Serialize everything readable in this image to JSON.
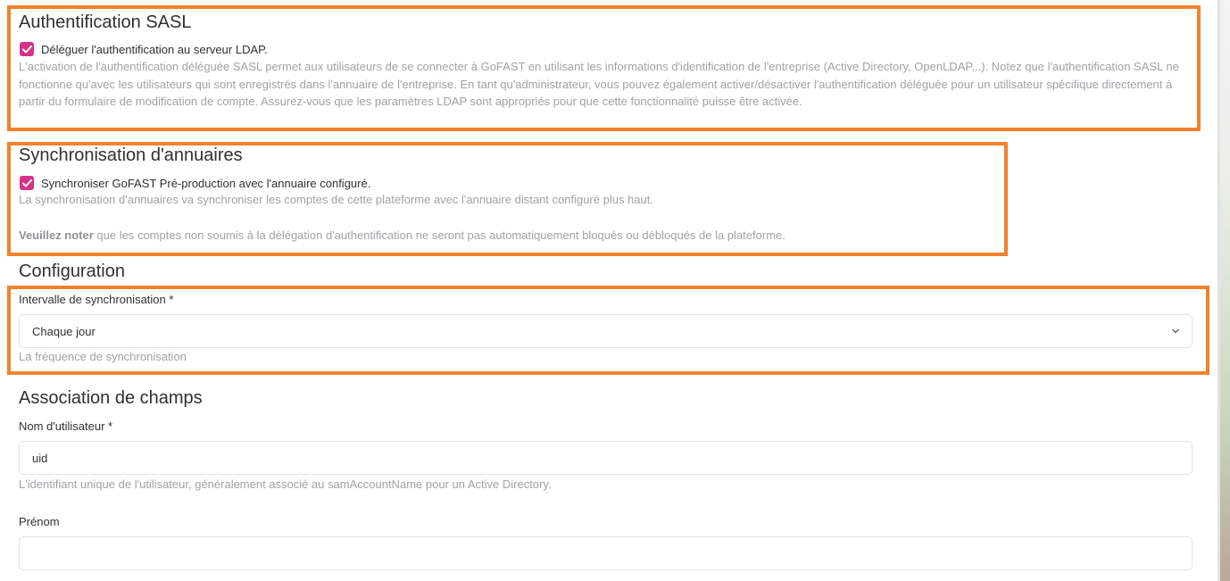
{
  "sasl": {
    "title": "Authentification SASL",
    "checkbox_label": "Déléguer l'authentification au serveur LDAP.",
    "description": "L'activation de l'authentification déléguée SASL permet aux utilisateurs de se connecter à GoFAST en utilisant les informations d'identification de l'entreprise (Active Directory, OpenLDAP...). Notez que l'authentification SASL ne fonctionne qu'avec les utilisateurs qui sont enregistrés dans l'annuaire de l'entreprise. En tant qu'administrateur, vous pouvez également activer/désactiver l'authentification déléguée pour un utilisateur spécifique directement à partir du formulaire de modification de compte. Assurez-vous que les paramètres LDAP sont appropriés pour que cette fonctionnalité puisse être activée."
  },
  "sync": {
    "title": "Synchronisation d'annuaires",
    "checkbox_label": "Synchroniser GoFAST Pré-production avec l'annuaire configuré.",
    "description": "La synchronisation d'annuaires va synchroniser les comptes de cette plateforme avec l'annuaire distant configuré plus haut.",
    "note_bold": "Veuillez noter",
    "note_rest": " que les comptes non soumis à la délégation d'authentification ne seront pas automatiquement bloqués ou débloqués de la plateforme."
  },
  "configuration": {
    "title": "Configuration",
    "interval_label": "Intervalle de synchronisation *",
    "interval_value": "Chaque jour",
    "interval_help": "La fréquence de synchronisation"
  },
  "mapping": {
    "title": "Association de champs",
    "username_label": "Nom d'utilisateur *",
    "username_value": "uid",
    "username_help": "L'identifiant unique de l'utilisateur, généralement associé au samAccountName pour un Active Directory.",
    "firstname_label": "Prénom",
    "firstname_value": ""
  },
  "colors": {
    "highlight": "#f0822d",
    "checkbox": "#d63384",
    "help_text": "#a0a2a6"
  },
  "icons": {
    "checkbox_check": "check-icon",
    "select_chevron": "chevron-down-icon"
  }
}
